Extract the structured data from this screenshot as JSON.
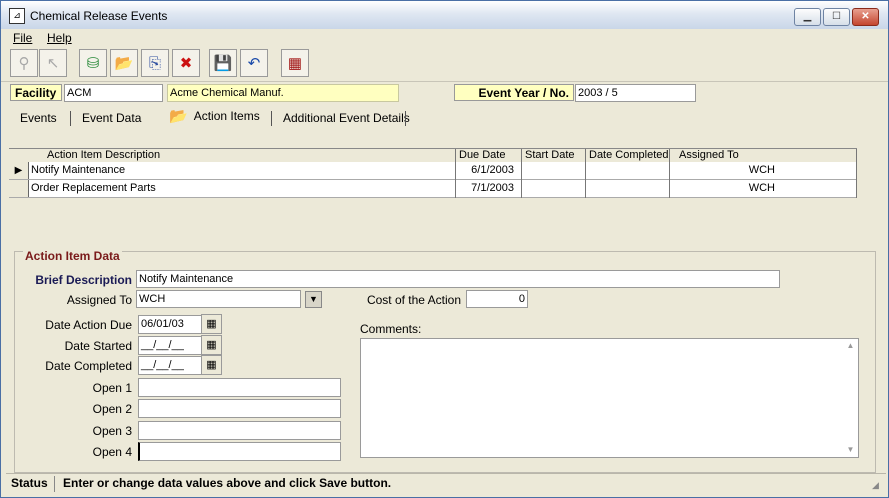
{
  "window": {
    "title": "Chemical Release Events",
    "minimize": "▁",
    "maximize": "☐",
    "close": "✕"
  },
  "menu": {
    "file": "File",
    "help": "Help"
  },
  "toolbar": {
    "buttons": [
      {
        "name": "network-icon",
        "glyph": "⚲"
      },
      {
        "name": "cursor-icon",
        "glyph": "↖"
      },
      {
        "name": "database-icon",
        "glyph": "⛁"
      },
      {
        "name": "open-folder-icon",
        "glyph": "📂"
      },
      {
        "name": "copy-icon",
        "glyph": "⎘"
      },
      {
        "name": "delete-icon",
        "glyph": "✖"
      },
      {
        "name": "save-icon",
        "glyph": "💾"
      },
      {
        "name": "undo-icon",
        "glyph": "↶"
      },
      {
        "name": "calculator-icon",
        "glyph": "▦"
      }
    ]
  },
  "header": {
    "facility_label": "Facility",
    "facility_code": "ACM",
    "facility_name": "Acme Chemical Manuf.",
    "event_label": "Event Year / No.",
    "event_value": "2003 / 5"
  },
  "tabs": [
    {
      "label": "Events"
    },
    {
      "label": "Event Data"
    },
    {
      "label": "Action Items",
      "icon": "open-folder-icon",
      "active": true
    },
    {
      "label": "Additional Event Details"
    }
  ],
  "grid": {
    "columns": [
      "Action Item Description",
      "Due Date",
      "Start  Date",
      "Date Completed",
      "Assigned To"
    ],
    "rows": [
      {
        "description": "Notify Maintenance",
        "due": "6/1/2003",
        "start": "",
        "completed": "",
        "assigned": "WCH",
        "current": true
      },
      {
        "description": "Order Replacement Parts",
        "due": "7/1/2003",
        "start": "",
        "completed": "",
        "assigned": "WCH",
        "current": false
      }
    ]
  },
  "form": {
    "group_title": "Action Item Data",
    "brief_description_label": "Brief Description",
    "brief_description": "Notify Maintenance",
    "assigned_to_label": "Assigned To",
    "assigned_to": "WCH",
    "cost_label": "Cost of the Action",
    "cost": "0",
    "date_due_label": "Date Action Due",
    "date_due": "06/01/03",
    "date_started_label": "Date Started",
    "date_started": "__/__/__",
    "date_completed_label": "Date Completed",
    "date_completed": "__/__/__",
    "comments_label": "Comments:",
    "comments": "",
    "open1_label": "Open 1",
    "open1": "",
    "open2_label": "Open 2",
    "open2": "",
    "open3_label": "Open 3",
    "open3": "",
    "open4_label": "Open 4",
    "open4": ""
  },
  "status": {
    "label": "Status",
    "message": "Enter or change data values above and click Save button."
  }
}
